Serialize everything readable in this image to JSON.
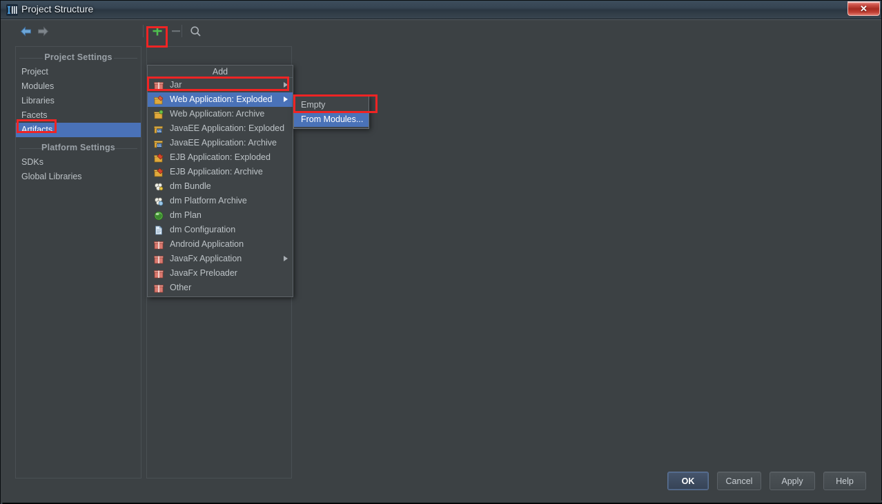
{
  "window": {
    "title": "Project Structure",
    "title_ghost": "…",
    "close_label": "✕",
    "app_icon": "intellij-idea-icon"
  },
  "toolbar": {
    "back_icon": "arrow-left-icon",
    "forward_icon": "arrow-right-icon",
    "add_icon": "plus-icon",
    "remove_icon": "minus-icon",
    "search_icon": "search-icon"
  },
  "sidebar": {
    "groups": [
      {
        "label": "Project Settings",
        "items": [
          {
            "label": "Project",
            "selected": false
          },
          {
            "label": "Modules",
            "selected": false
          },
          {
            "label": "Libraries",
            "selected": false
          },
          {
            "label": "Facets",
            "selected": false
          },
          {
            "label": "Artifacts",
            "selected": true
          }
        ]
      },
      {
        "label": "Platform Settings",
        "items": [
          {
            "label": "SDKs",
            "selected": false
          },
          {
            "label": "Global Libraries",
            "selected": false
          }
        ]
      }
    ]
  },
  "add_menu": {
    "title": "Add",
    "items": [
      {
        "label": "Jar",
        "icon": "jar-package-icon",
        "submenu": true,
        "selected": false
      },
      {
        "label": "Web Application: Exploded",
        "icon": "web-exploded-icon",
        "submenu": true,
        "selected": true
      },
      {
        "label": "Web Application: Archive",
        "icon": "web-archive-icon",
        "submenu": false,
        "selected": false
      },
      {
        "label": "JavaEE Application: Exploded",
        "icon": "javaee-exploded-icon",
        "submenu": false,
        "selected": false
      },
      {
        "label": "JavaEE Application: Archive",
        "icon": "javaee-archive-icon",
        "submenu": false,
        "selected": false
      },
      {
        "label": "EJB Application: Exploded",
        "icon": "ejb-exploded-icon",
        "submenu": false,
        "selected": false
      },
      {
        "label": "EJB Application: Archive",
        "icon": "ejb-archive-icon",
        "submenu": false,
        "selected": false
      },
      {
        "label": "dm Bundle",
        "icon": "dm-bundle-icon",
        "submenu": false,
        "selected": false
      },
      {
        "label": "dm Platform Archive",
        "icon": "dm-platform-archive-icon",
        "submenu": false,
        "selected": false
      },
      {
        "label": "dm Plan",
        "icon": "dm-plan-globe-icon",
        "submenu": false,
        "selected": false
      },
      {
        "label": "dm Configuration",
        "icon": "document-icon",
        "submenu": false,
        "selected": false
      },
      {
        "label": "Android Application",
        "icon": "android-package-icon",
        "submenu": false,
        "selected": false
      },
      {
        "label": "JavaFx Application",
        "icon": "javafx-package-icon",
        "submenu": true,
        "selected": false
      },
      {
        "label": "JavaFx Preloader",
        "icon": "javafx-preloader-icon",
        "submenu": false,
        "selected": false
      },
      {
        "label": "Other",
        "icon": "other-package-icon",
        "submenu": false,
        "selected": false
      }
    ]
  },
  "submenu": {
    "items": [
      {
        "label": "Empty",
        "selected": false
      },
      {
        "label": "From Modules...",
        "selected": true
      }
    ]
  },
  "buttons": [
    {
      "label": "OK",
      "primary": true,
      "mnemonic": "",
      "cls": "btn-ok"
    },
    {
      "label": "Cancel",
      "primary": false,
      "mnemonic": "",
      "cls": "btn-cancel"
    },
    {
      "label": "Apply",
      "primary": false,
      "mnemonic": "A",
      "cls": "btn-apply"
    },
    {
      "label": "Help",
      "primary": false,
      "mnemonic": "",
      "cls": "btn-help"
    }
  ],
  "annotations": {
    "color": "#f02424",
    "boxes": [
      "add-plus-button",
      "sidebar-item-artifacts",
      "menu-item-web-application-exploded",
      "submenu-item-from-modules"
    ]
  }
}
